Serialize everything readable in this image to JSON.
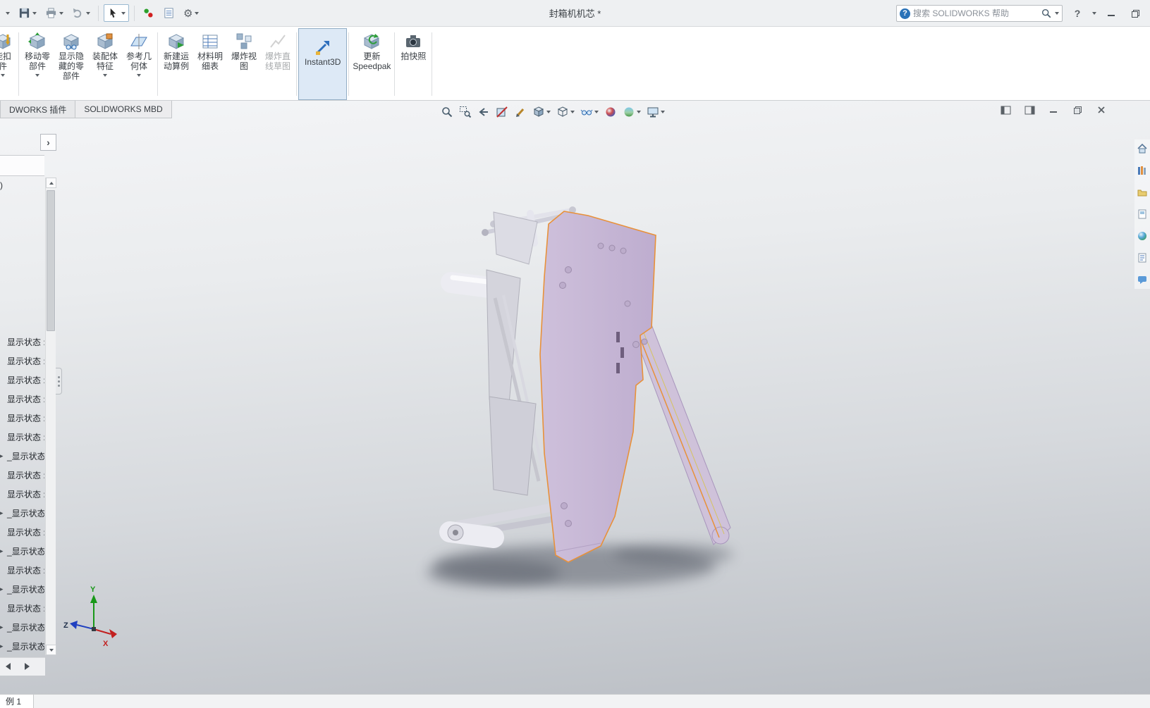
{
  "titlebar": {
    "title": "封箱机机芯 *",
    "search": {
      "placeholder": "搜索 SOLIDWORKS 帮助",
      "value": ""
    },
    "help_label": "?"
  },
  "icons": {
    "gear": "⚙",
    "help_badge": "?",
    "flyout_arrow": "›"
  },
  "doc_tabs": [
    {
      "label": "DWORKS 插件"
    },
    {
      "label": "SOLIDWORKS MBD"
    }
  ],
  "ribbon": {
    "buttons": [
      {
        "lines": [
          "能扣",
          "件"
        ]
      },
      {
        "lines": [
          "移动零",
          "部件"
        ]
      },
      {
        "lines": [
          "显示隐",
          "藏的零",
          "部件"
        ]
      },
      {
        "lines": [
          "装配体",
          "特征"
        ]
      },
      {
        "lines": [
          "参考几",
          "何体"
        ]
      },
      {
        "lines": [
          "新建运",
          "动算例"
        ]
      },
      {
        "lines": [
          "材料明",
          "细表"
        ]
      },
      {
        "lines": [
          "爆炸视",
          "图"
        ]
      },
      {
        "lines": [
          "爆炸直",
          "线草图"
        ]
      },
      {
        "lines": [
          "Instant3D"
        ]
      },
      {
        "lines": [
          "更新",
          "Speedpak"
        ]
      },
      {
        "lines": [
          "拍快照"
        ]
      }
    ]
  },
  "tree": {
    "top_item": ")",
    "items": [
      {
        "expander": "",
        "label": "显示状态 :"
      },
      {
        "expander": "",
        "label": "显示状态 :"
      },
      {
        "expander": "",
        "label": "显示状态 :"
      },
      {
        "expander": "",
        "label": "显示状态 :"
      },
      {
        "expander": "",
        "label": "显示状态 :"
      },
      {
        "expander": "",
        "label": "显示状态 :"
      },
      {
        "expander": "▸",
        "label": "_显示状态 :"
      },
      {
        "expander": "",
        "label": "显示状态 :"
      },
      {
        "expander": "",
        "label": "显示状态 :"
      },
      {
        "expander": "▸",
        "label": "_显示状态"
      },
      {
        "expander": "",
        "label": "显示状态 :"
      },
      {
        "expander": "▸",
        "label": "_显示状态"
      },
      {
        "expander": "",
        "label": "显示状态 :"
      },
      {
        "expander": "▸",
        "label": "_显示状态"
      },
      {
        "expander": "",
        "label": "显示状态 :"
      },
      {
        "expander": "▸",
        "label": "_显示状态"
      },
      {
        "expander": "▸",
        "label": "_显示状态"
      }
    ]
  },
  "triad": {
    "x": "X",
    "y": "Y",
    "z": "Z"
  },
  "bottom": {
    "tab_label": "例 1"
  },
  "colors": {
    "selection_orange": "#e8913a",
    "model_fill": "#c9bad6",
    "instant3d_bg": "#dde9f6",
    "viewport_top": "#f4f5f7",
    "viewport_bottom": "#b9bdc3"
  }
}
